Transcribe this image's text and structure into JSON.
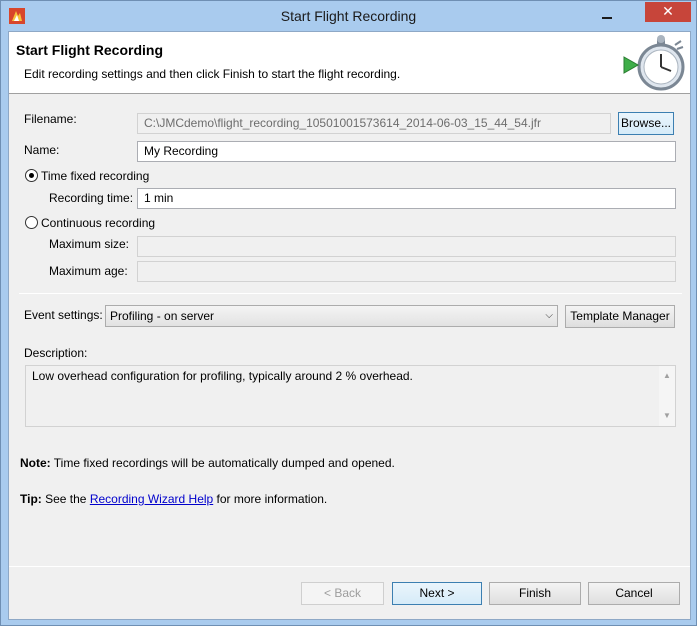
{
  "window": {
    "title": "Start Flight Recording",
    "close_glyph": "✕"
  },
  "banner": {
    "title": "Start Flight Recording",
    "description": "Edit recording settings and then click Finish to start the flight recording."
  },
  "form": {
    "filename_label": "Filename:",
    "filename_value": "C:\\JMCdemo\\flight_recording_10501001573614_2014-06-03_15_44_54.jfr",
    "browse_label": "Browse...",
    "name_label": "Name:",
    "name_value": "My Recording",
    "time_fixed_label": "Time fixed recording",
    "time_fixed_checked": true,
    "recording_time_label": "Recording time:",
    "recording_time_value": "1 min",
    "continuous_label": "Continuous recording",
    "continuous_checked": false,
    "max_size_label": "Maximum size:",
    "max_size_value": "",
    "max_age_label": "Maximum age:",
    "max_age_value": ""
  },
  "events": {
    "label": "Event settings:",
    "selected": "Profiling - on server",
    "template_manager_label": "Template Manager",
    "description_label": "Description:",
    "description_text": "Low overhead configuration for profiling, typically around 2 % overhead."
  },
  "notes": {
    "note_prefix": "Note:",
    "note_text": " Time fixed recordings will be automatically dumped and opened.",
    "tip_prefix": "Tip:",
    "tip_before": " See the ",
    "tip_link": "Recording Wizard Help",
    "tip_after": " for more information."
  },
  "buttons": {
    "back_label": "< Back",
    "next_label": "Next >",
    "finish_label": "Finish",
    "cancel_label": "Cancel"
  },
  "colors": {
    "window_frame": "#a9cbee",
    "close_button": "#c7453a",
    "link": "#0000cc"
  },
  "icons": {
    "app": "flame-icon",
    "banner": "stopwatch-play-icon"
  }
}
